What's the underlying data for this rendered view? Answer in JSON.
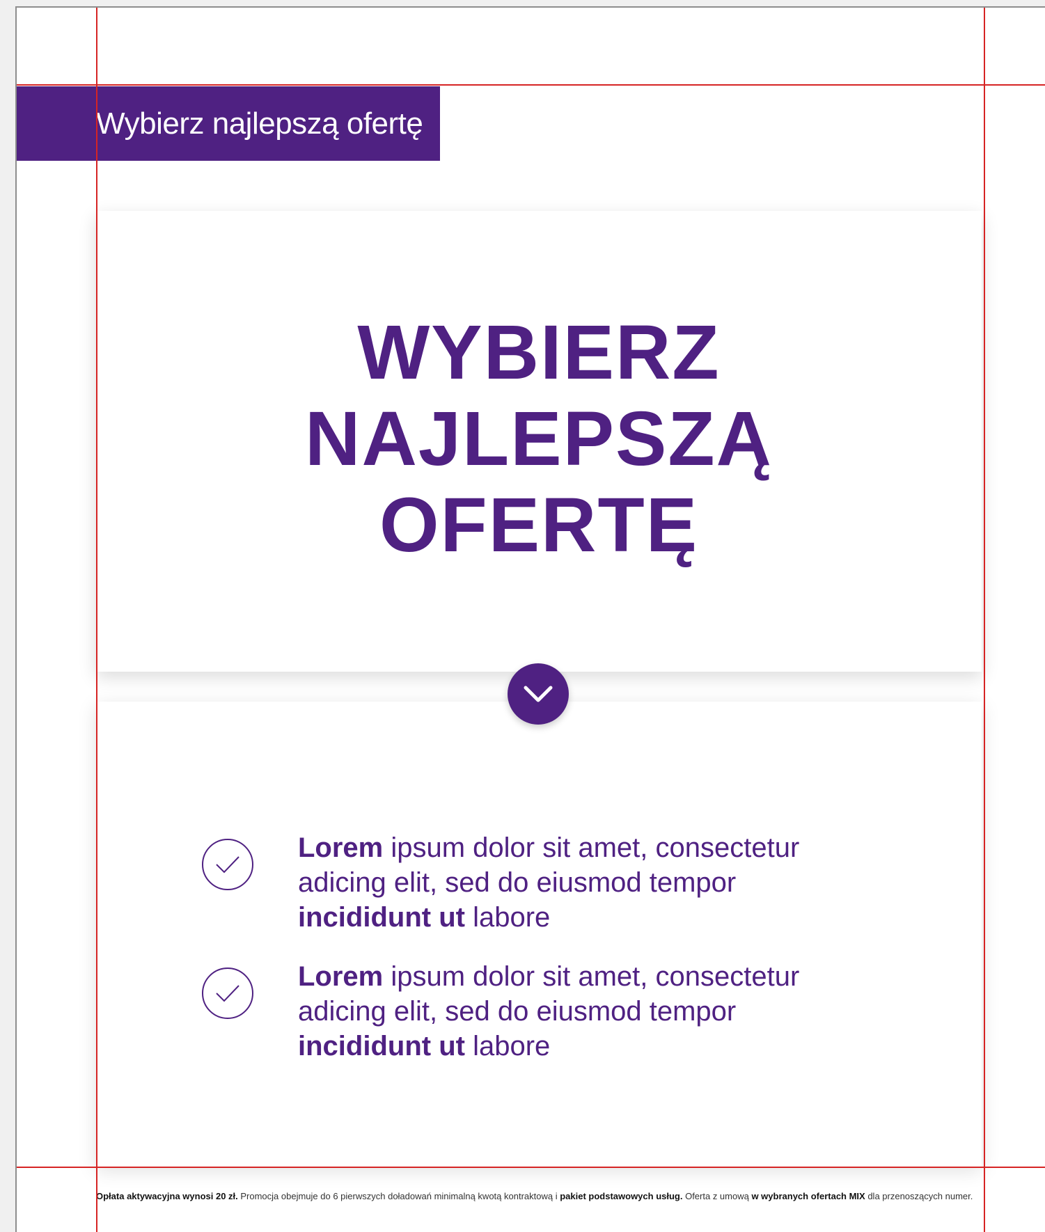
{
  "tab_label": "Wybierz najlepszą ofertę",
  "hero": {
    "title": "WYBIERZ\nNAJLEPSZĄ\nOFERTĘ"
  },
  "scroll_button": {
    "icon": "chevron-down-icon"
  },
  "features": [
    {
      "bold1": "Lorem",
      "text1": " ipsum dolor sit amet, consectetur adicing elit, sed do eiusmod tempor ",
      "bold2": "incididunt ut",
      "text2": " labore"
    },
    {
      "bold1": "Lorem",
      "text1": " ipsum dolor sit amet, consectetur adicing elit, sed do eiusmod tempor ",
      "bold2": "incididunt ut",
      "text2": " labore"
    }
  ],
  "footnote": {
    "b1": "Opłata aktywacyjna wynosi 20 zł.",
    "t1": " Promocja obejmuje do 6 pierwszych doładowań minimalną kwotą kontraktową i ",
    "b2": "pakiet podstawowych usług.",
    "t2": " Oferta z umową ",
    "b3": "w wybranych ofertach MIX",
    "t3": " dla przenoszących numer."
  },
  "colors": {
    "brand": "#4f2182",
    "guide": "#d62424"
  }
}
